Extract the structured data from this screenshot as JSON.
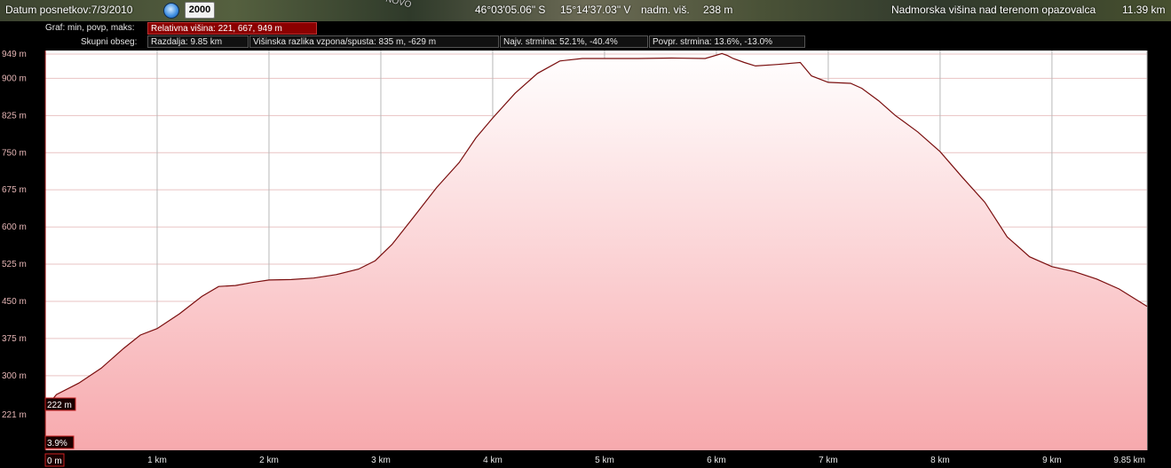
{
  "topbar": {
    "date": "Datum posnetkov:7/3/2010",
    "year": "2000",
    "lat": "46°03'05.06\" S",
    "lon": "15°14'37.03\" V",
    "elev_label": "nadm. viš.",
    "elev_value": "238 m",
    "eye_label": "Nadmorska višina nad terenom opazovalca",
    "eye_value": "11.39 km",
    "map_text": "NOVO"
  },
  "info": {
    "graph_label": "Graf: min, povp, maks:",
    "graph_value": "Relativna višina: 221, 667, 949 m",
    "range_label": "Skupni obseg:",
    "distance": "Razdalja: 9.85 km",
    "elevation_gain": "Višinska razlika vzpona/spusta: 835 m, -629 m",
    "max_slope": "Najv. strmina: 52.1%, -40.4%",
    "avg_slope": "Povpr. strmina: 13.6%, -13.0%"
  },
  "cursor": {
    "elevation": "222 m",
    "slope": "3.9%",
    "distance": "0 m"
  },
  "chart_data": {
    "type": "area",
    "ylim": [
      221,
      949
    ],
    "xlim": [
      0,
      9.85
    ],
    "y_ticks": [
      {
        "v": 221,
        "label": "221 m"
      },
      {
        "v": 300,
        "label": "300 m"
      },
      {
        "v": 375,
        "label": "375 m"
      },
      {
        "v": 450,
        "label": "450 m"
      },
      {
        "v": 525,
        "label": "525 m"
      },
      {
        "v": 600,
        "label": "600 m"
      },
      {
        "v": 675,
        "label": "675 m"
      },
      {
        "v": 750,
        "label": "750 m"
      },
      {
        "v": 825,
        "label": "825 m"
      },
      {
        "v": 900,
        "label": "900 m"
      },
      {
        "v": 949,
        "label": "949 m"
      }
    ],
    "x_ticks": [
      {
        "v": 1,
        "label": "1 km"
      },
      {
        "v": 2,
        "label": "2 km"
      },
      {
        "v": 3,
        "label": "3 km"
      },
      {
        "v": 4,
        "label": "4 km"
      },
      {
        "v": 5,
        "label": "5 km"
      },
      {
        "v": 6,
        "label": "6 km"
      },
      {
        "v": 7,
        "label": "7 km"
      },
      {
        "v": 8,
        "label": "8 km"
      },
      {
        "v": 9,
        "label": "9 km"
      },
      {
        "v": 9.85,
        "label": "9.85 km"
      }
    ],
    "x": [
      0,
      0.1,
      0.3,
      0.5,
      0.7,
      0.85,
      1.0,
      1.2,
      1.4,
      1.55,
      1.7,
      1.85,
      2.0,
      2.2,
      2.4,
      2.6,
      2.8,
      2.95,
      3.1,
      3.3,
      3.5,
      3.7,
      3.85,
      4.0,
      4.2,
      4.4,
      4.6,
      4.8,
      5.0,
      5.3,
      5.6,
      5.9,
      6.05,
      6.1,
      6.15,
      6.25,
      6.35,
      6.55,
      6.75,
      6.85,
      7.0,
      7.2,
      7.3,
      7.45,
      7.6,
      7.8,
      8.0,
      8.2,
      8.4,
      8.6,
      8.8,
      9.0,
      9.2,
      9.4,
      9.6,
      9.85
    ],
    "y": [
      235,
      262,
      285,
      315,
      355,
      382,
      395,
      425,
      460,
      480,
      482,
      488,
      493,
      494,
      497,
      504,
      515,
      532,
      565,
      622,
      680,
      730,
      780,
      820,
      870,
      910,
      935,
      940,
      940,
      940,
      941,
      940,
      950,
      946,
      940,
      932,
      925,
      928,
      932,
      905,
      892,
      890,
      880,
      855,
      825,
      792,
      752,
      700,
      650,
      580,
      540,
      520,
      510,
      495,
      475,
      440
    ],
    "color": "#7a0e0e"
  }
}
